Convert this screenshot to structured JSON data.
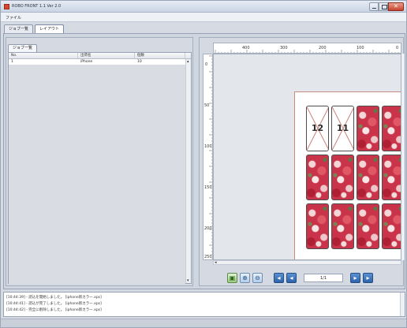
{
  "window": {
    "title": "ROBO FRONT 1.1 Ver 2.0"
  },
  "menu": {
    "items": [
      "ファイル"
    ]
  },
  "tabs": [
    {
      "label": "ジョブ一覧",
      "active": false
    },
    {
      "label": "レイアウト",
      "active": true
    }
  ],
  "left_panel": {
    "sub_tab": "ジョブ一覧",
    "columns": [
      "No.",
      "出荷名",
      "個数"
    ],
    "rows": [
      {
        "no": "1",
        "name": "iPhone",
        "qty": "10"
      }
    ]
  },
  "preview": {
    "ruler_top_labels": [
      "400",
      "300",
      "200",
      "100",
      "0"
    ],
    "ruler_left_labels": [
      "0",
      "50",
      "100",
      "150",
      "200",
      "250"
    ],
    "empty_cells": [
      {
        "number": "12"
      },
      {
        "number": "11"
      }
    ]
  },
  "toolbar": {
    "page_indicator": "1/1"
  },
  "log": {
    "lines": [
      "[10:44:39] - 読込を開始しました。 [iphone新カラー.xps]",
      "[10:44:41] - 読込が完了しました。 [iphone新カラー.xps]",
      "[10:44:42] - 完全に削除しました。 [iphone新カラー.xps]"
    ]
  },
  "colors": {
    "accent": "#d8462c",
    "paper_border": "#c98a84",
    "floral": "#c9344a"
  }
}
